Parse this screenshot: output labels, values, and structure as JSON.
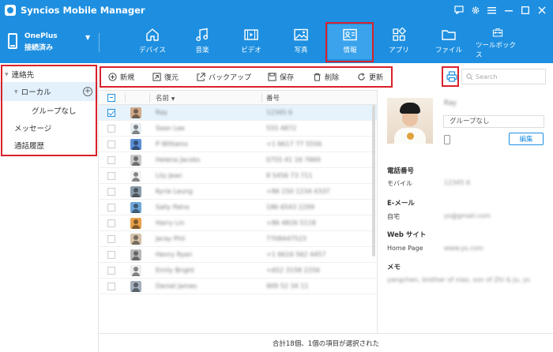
{
  "app": {
    "title": "Syncios Mobile Manager"
  },
  "device": {
    "name": "OnePlus",
    "status": "接続済み"
  },
  "nav": {
    "tabs": [
      {
        "label": "デバイス",
        "icon": "home-icon"
      },
      {
        "label": "音楽",
        "icon": "music-icon"
      },
      {
        "label": "ビデオ",
        "icon": "film-icon"
      },
      {
        "label": "写真",
        "icon": "image-icon"
      },
      {
        "label": "情報",
        "icon": "contact-card-icon",
        "active": true
      },
      {
        "label": "アプリ",
        "icon": "apps-icon"
      },
      {
        "label": "ファイル",
        "icon": "folder-icon"
      },
      {
        "label": "ツールボックス",
        "icon": "toolbox-icon"
      }
    ]
  },
  "sidebar": {
    "items": [
      {
        "label": "連絡先"
      },
      {
        "label": "ローカル"
      },
      {
        "label": "グループなし"
      },
      {
        "label": "メッセージ"
      },
      {
        "label": "通話履歴"
      }
    ]
  },
  "toolbar": {
    "new": "新規",
    "restore": "復元",
    "backup": "バックアップ",
    "save": "保存",
    "delete": "削除",
    "refresh": "更新",
    "search_placeholder": "Search"
  },
  "table": {
    "columns": [
      "名前",
      "番号"
    ],
    "rows": [
      {
        "name": "Ray",
        "phone": "12345 6",
        "selected": true,
        "avatar": "#cfa98a"
      },
      {
        "name": "Sean Lee",
        "phone": "555 4872",
        "avatar": "#e7eef3"
      },
      {
        "name": "P Williams",
        "phone": "+1 6617 77 5556",
        "avatar": "#5b8ed6"
      },
      {
        "name": "Helena Jacobs",
        "phone": "0755 41 16 7669",
        "avatar": "#c9c9c9"
      },
      {
        "name": "Lily Jean",
        "phone": "8 5456 73 711",
        "avatar": "#f3f3f3"
      },
      {
        "name": "Kyrie Leung",
        "phone": "+86 150 1234 4337",
        "avatar": "#8a9aa8"
      },
      {
        "name": "Sally Patra",
        "phone": "186 6543 2299",
        "avatar": "#6fa6d8"
      },
      {
        "name": "Harry Lin",
        "phone": "+86 4826 5118",
        "avatar": "#e7a04a"
      },
      {
        "name": "Jeray Phil",
        "phone": "7708447523",
        "avatar": "#d5c2a8"
      },
      {
        "name": "Henry Ryan",
        "phone": "+1 6616 562 4457",
        "avatar": "#b8b8b8"
      },
      {
        "name": "Emily Bright",
        "phone": "+652 3158 2256",
        "avatar": "#ededed"
      },
      {
        "name": "Daniel James",
        "phone": "909 52 34 11",
        "avatar": "#a4b0bc"
      }
    ]
  },
  "status": {
    "text": "合計18個、1個の項目が選択された"
  },
  "detail": {
    "name": "Ray",
    "group": "グループなし",
    "edit": "編集",
    "phone_heading": "電話番号",
    "mobile_label": "モバイル",
    "mobile_value": "12345 6",
    "email_heading": "E-メール",
    "home_label": "自宅",
    "home_value": "ys@gmail.com",
    "web_heading": "Web サイト",
    "homepage_label": "Home Page",
    "homepage_value": "www.ys.com",
    "memo_heading": "メモ",
    "memo_value": "yangchen, brother of xiao, son of Zhi & Ju, ys"
  },
  "colors": {
    "brand": "#1e8fe0",
    "highlight": "#d8212a",
    "selected_row": "#e6f3fd"
  }
}
